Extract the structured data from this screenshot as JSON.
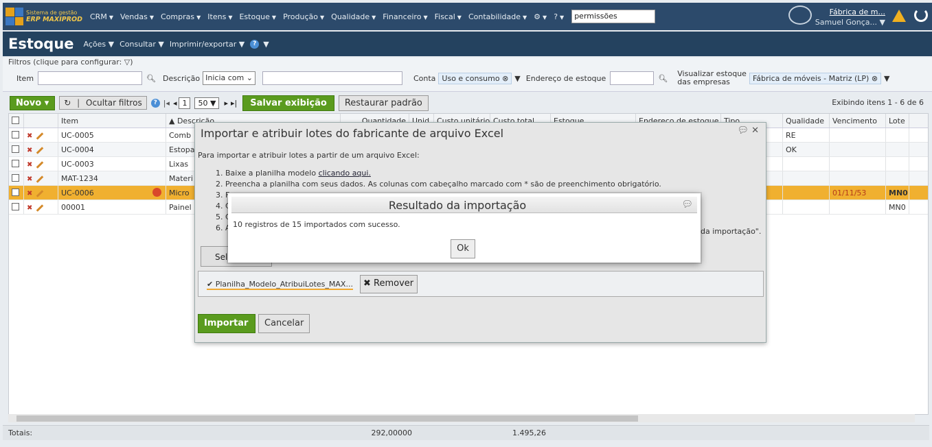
{
  "topbar": {
    "logo_line1": "Sistema de gestão",
    "logo_line2": "ERP MAXIPROD",
    "menu": [
      "CRM",
      "Vendas",
      "Compras",
      "Itens",
      "Estoque",
      "Produção",
      "Qualidade",
      "Financeiro",
      "Fiscal",
      "Contabilidade"
    ],
    "search_value": "permissões",
    "company": "Fábrica de m...",
    "user": "Samuel Gonça..."
  },
  "titlebar": {
    "title": "Estoque",
    "menu": [
      "Ações",
      "Consultar",
      "Imprimir/exportar"
    ]
  },
  "filters": {
    "legend": "Filtros (clique para configurar:",
    "item_label": "Item",
    "desc_label": "Descrição",
    "desc_mode": "Inicia com",
    "conta_label": "Conta",
    "conta_tag": "Uso e consumo",
    "endereco_label": "Endereço de estoque",
    "visualizar_label1": "Visualizar estoque",
    "visualizar_label2": "das empresas",
    "empresa_tag": "Fábrica de móveis - Matriz (LP)"
  },
  "toolbar": {
    "novo": "Novo",
    "ocultar": "Ocultar filtros",
    "page": "1",
    "per_page": "50",
    "salvar": "Salvar exibição",
    "restaurar": "Restaurar padrão",
    "showing": "Exibindo itens 1 - 6 de 6"
  },
  "table": {
    "headers": [
      "Item",
      "▲ Descrição",
      "Quantidade",
      "Unid.",
      "Custo unitário",
      "Custo total",
      "Estoque",
      "Endereço de estoque",
      "Tipo",
      "Qualidade",
      "Vencimento",
      "Lote"
    ],
    "rows": [
      {
        "item": "UC-0005",
        "desc": "Comb",
        "qualidade": "RE",
        "venc": "",
        "lote": ""
      },
      {
        "item": "UC-0004",
        "desc": "Estopa",
        "qualidade": "OK",
        "venc": "",
        "lote": ""
      },
      {
        "item": "UC-0003",
        "desc": "Lixas",
        "qualidade": "",
        "venc": "",
        "lote": ""
      },
      {
        "item": "MAT-1234",
        "desc": "Materi",
        "qualidade": "",
        "venc": "",
        "lote": ""
      },
      {
        "item": "UC-0006",
        "desc": "Micro",
        "qualidade": "",
        "venc": "01/11/53",
        "lote": "MN0"
      },
      {
        "item": "00001",
        "desc": "Painel",
        "qualidade": "",
        "venc": "",
        "lote": "MN0"
      }
    ],
    "totals_label": "Totais:",
    "total_qty": "292,00000",
    "total_cost": "1.495,26"
  },
  "dialog_import": {
    "title": "Importar e atribuir lotes do fabricante de arquivo Excel",
    "intro": "Para importar e atribuir lotes a partir de um arquivo Excel:",
    "step1_prefix": "1. Baixe a planilha modelo ",
    "step1_link": "clicando aqui.",
    "step2": "2. Preencha a planilha com seus dados. As colunas com cabeçalho marcado com * são de preenchimento obrigatório.",
    "step3": "3. F",
    "step4": "4. C",
    "step5": "5. C",
    "step6": "6. A",
    "tail_text": "da importação\".",
    "select_btn": "Sele",
    "file_name": "Planilha_Modelo_AtribuiLotes_MAX...",
    "remove_btn": "Remover",
    "import_btn": "Importar",
    "cancel_btn": "Cancelar"
  },
  "dialog_result": {
    "title": "Resultado da importação",
    "message": "10 registros de 15 importados com sucesso.",
    "ok": "Ok"
  }
}
